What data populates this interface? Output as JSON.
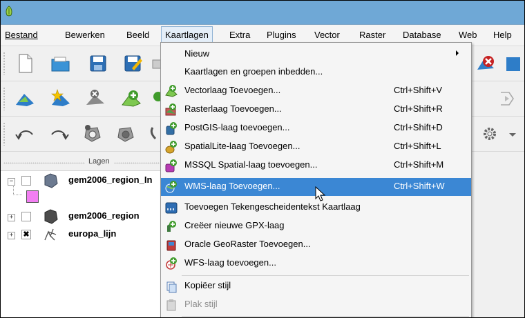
{
  "menubar": {
    "items": [
      {
        "label": "Bestand"
      },
      {
        "label": "Bewerken"
      },
      {
        "label": "Beeld"
      },
      {
        "label": "Kaartlagen"
      },
      {
        "label": "Extra"
      },
      {
        "label": "Plugins"
      },
      {
        "label": "Vector"
      },
      {
        "label": "Raster"
      },
      {
        "label": "Database"
      },
      {
        "label": "Web"
      },
      {
        "label": "Help"
      }
    ],
    "active": "Kaartlagen"
  },
  "layers_panel": {
    "title": "Lagen",
    "layers": [
      {
        "name": "gem2006_region_In",
        "expander": "−",
        "checked": false
      },
      {
        "name": "gem2006_region",
        "expander": "+",
        "checked": false
      },
      {
        "name": "europa_lijn",
        "expander": "+",
        "checked": true,
        "check_mark": "✖"
      }
    ],
    "legend_color": "#f27ef2"
  },
  "dropdown": {
    "items": [
      {
        "label": "Nieuw",
        "shortcut": "",
        "icon": "",
        "submenu": true
      },
      {
        "label": "Kaartlagen en groepen inbedden...",
        "shortcut": "",
        "icon": ""
      },
      {
        "label": "Vectorlaag Toevoegen...",
        "shortcut": "Ctrl+Shift+V",
        "icon": "add-vector-icon"
      },
      {
        "label": "Rasterlaag Toevoegen...",
        "shortcut": "Ctrl+Shift+R",
        "icon": "add-raster-icon"
      },
      {
        "label": "PostGIS-laag toevoegen...",
        "shortcut": "Ctrl+Shift+D",
        "icon": "add-postgis-icon"
      },
      {
        "label": "SpatialLite-laag Toevoegen...",
        "shortcut": "Ctrl+Shift+L",
        "icon": "add-spatialite-icon"
      },
      {
        "label": "MSSQL Spatial-laag toevoegen...",
        "shortcut": "Ctrl+Shift+M",
        "icon": "add-mssql-icon"
      },
      {
        "label": "WMS-laag Toevoegen...",
        "shortcut": "Ctrl+Shift+W",
        "icon": "add-wms-icon",
        "highlighted": true
      },
      {
        "label": "Toevoegen Tekengescheidentekst Kaartlaag",
        "shortcut": "",
        "icon": "add-delimited-text-icon"
      },
      {
        "label": "Creëer nieuwe GPX-laag",
        "shortcut": "",
        "icon": "create-gpx-icon"
      },
      {
        "label": "Oracle GeoRaster Toevoegen...",
        "shortcut": "",
        "icon": "add-oracle-georaster-icon"
      },
      {
        "label": "WFS-laag toevoegen...",
        "shortcut": "",
        "icon": "add-wfs-icon"
      },
      {
        "label": "Kopiëer stijl",
        "shortcut": "",
        "icon": "copy-style-icon"
      },
      {
        "label": "Plak stijl",
        "shortcut": "",
        "icon": "paste-style-icon",
        "disabled": true
      }
    ]
  },
  "colors": {
    "titlebar": "#6fa8d6",
    "highlight": "#3b87d4",
    "menu_active": "#e4eef8"
  }
}
